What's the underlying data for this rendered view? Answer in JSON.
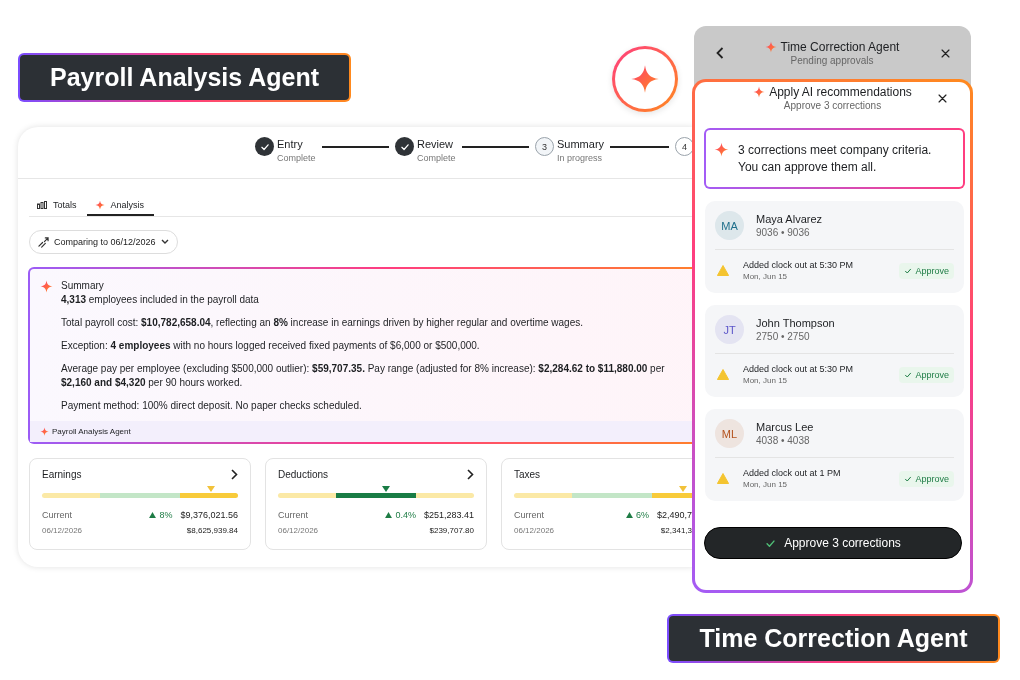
{
  "badges": [
    {
      "label": "Payroll Analysis Agent"
    },
    {
      "label": "Time Correction Agent"
    }
  ],
  "payroll": {
    "stepper": [
      {
        "label": "Entry",
        "sub": "Complete",
        "kind": "complete"
      },
      {
        "label": "Review",
        "sub": "Complete",
        "kind": "complete"
      },
      {
        "number": "3",
        "label": "Summary",
        "sub": "In progress",
        "kind": "current"
      },
      {
        "number": "4",
        "kind": "upcoming"
      }
    ],
    "tabs": [
      {
        "label": "Totals",
        "selected": false
      },
      {
        "label": "Analysis",
        "selected": true
      }
    ],
    "compare_button": "Comparing to 06/12/2026",
    "summary": {
      "title": "Summary",
      "paragraphs": [
        {
          "lines": [
            "**4,313** employees included in the payroll data"
          ]
        },
        {
          "lines": [
            "Total payroll cost: **$10,782,658.04**, reflecting an **8%** increase in earnings driven by higher regular and overtime wages."
          ]
        },
        {
          "lines": [
            "Exception: **4 employees** with no hours logged received fixed payments of $6,000 or $500,000."
          ]
        },
        {
          "lines": [
            "Average pay per employee (excluding $500,000 outlier): **$59,707.35.** Pay range (adjusted for 8% increase): **$2,284.62 to $11,880.00** per",
            "**$2,160 and $4,320** per 90 hours worked."
          ]
        },
        {
          "lines": [
            "Payment method: 100% direct deposit. No paper checks scheduled."
          ]
        }
      ],
      "footer": "Payroll Analysis Agent"
    },
    "cards": [
      {
        "title": "Earnings",
        "chevron": true,
        "kind": "high",
        "current_label": "Current",
        "change": "8%",
        "current": "$9,376,021.56",
        "date": "06/12/2026",
        "previous": "$8,625,939.84"
      },
      {
        "title": "Deductions",
        "chevron": true,
        "kind": "normal",
        "current_label": "Current",
        "change": "0.4%",
        "current": "$251,283.41",
        "date": "06/12/2026",
        "previous": "$239,707.80"
      },
      {
        "title": "Taxes",
        "kind": "high",
        "current_label": "Current",
        "change": "6%",
        "current": "$2,490,7",
        "date": "06/12/2026",
        "previous": "$2,341,3"
      }
    ]
  },
  "agent_panel": {
    "title": "Time Correction Agent",
    "subtitle": "Pending approvals"
  },
  "recommendations": {
    "title": "Apply AI recommendations",
    "subtitle": "Approve 3 corrections",
    "callout": "3 corrections meet company criteria. You can approve them all.",
    "employees": [
      {
        "initials": "MA",
        "color": "#1f6f8b",
        "name": "Maya Alvarez",
        "ids": "9036 • 9036",
        "correction": "Added clock out at 5:30 PM",
        "date": "Mon, Jun 15",
        "action": "Approve"
      },
      {
        "initials": "JT",
        "color": "#5b55c9",
        "name": "John Thompson",
        "ids": "2750 • 2750",
        "correction": "Added clock out at 5:30 PM",
        "date": "Mon, Jun 15",
        "action": "Approve"
      },
      {
        "initials": "ML",
        "color": "#b4531f",
        "name": "Marcus Lee",
        "ids": "4038 • 4038",
        "correction": "Added clock out at 1 PM",
        "date": "Mon, Jun 15",
        "action": "Approve"
      }
    ],
    "approve_all": "Approve 3 corrections"
  }
}
